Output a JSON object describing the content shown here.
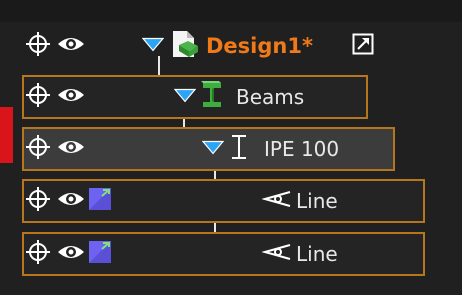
{
  "tree": {
    "root": {
      "label": "Design1*"
    },
    "beams": {
      "label": "Beams"
    },
    "profile": {
      "label": "IPE 100"
    },
    "line1": {
      "label": "Line"
    },
    "line2": {
      "label": "Line"
    }
  },
  "colors": {
    "background": "#202020",
    "row_border": "#b5761e",
    "root_label": "#f07a1a",
    "expand_arrow": "#2aa4f4",
    "status_marker": "#d9141b",
    "visibility_icon": "#ffffff",
    "target_icon": "#ffffff"
  },
  "icons": {
    "visibility": "eye-icon",
    "snap": "crosshair-icon",
    "expand": "triangle-down-icon",
    "design": "design-document-icon",
    "external": "open-external-icon",
    "beam": "beam-icon",
    "profile": "i-beam-profile-icon",
    "layer": "layer-color-icon",
    "line": "line-segment-icon"
  }
}
